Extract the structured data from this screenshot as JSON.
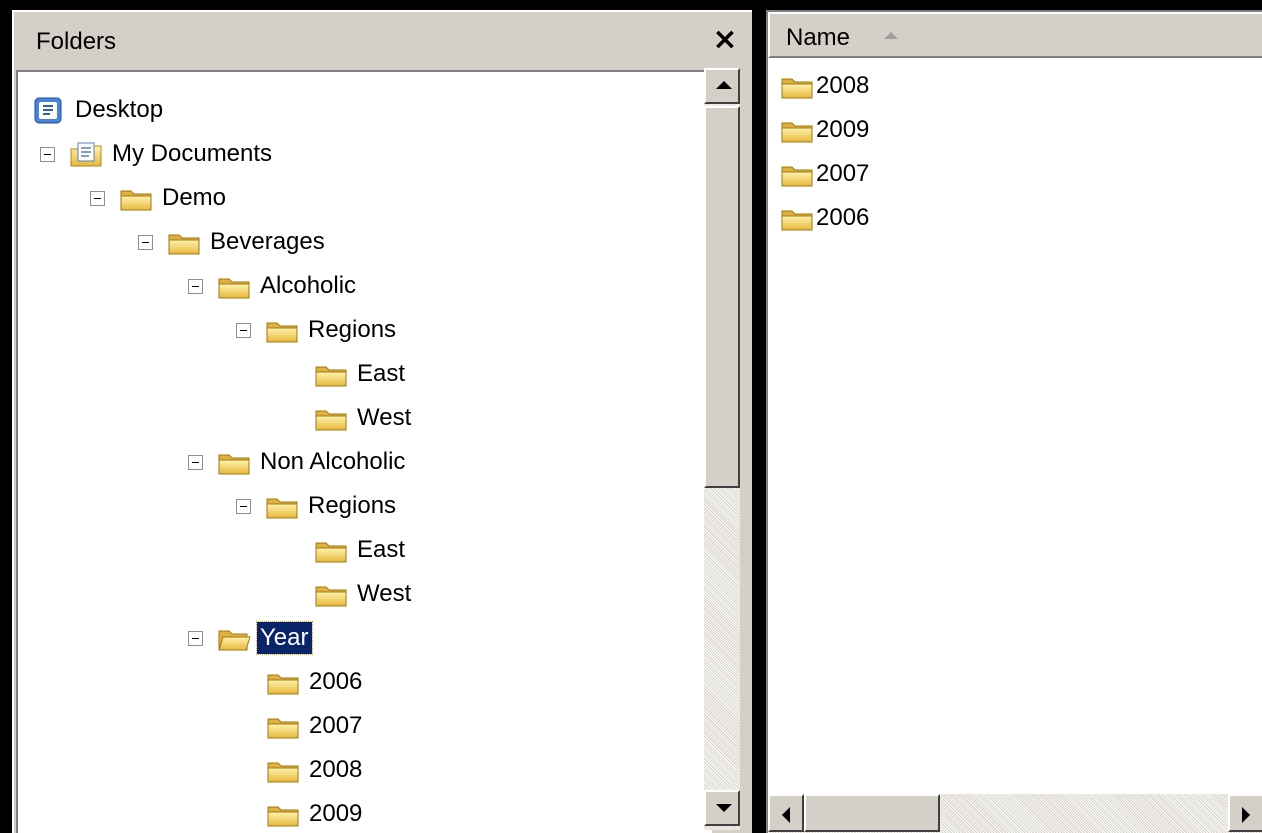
{
  "folders_pane": {
    "title": "Folders",
    "close_glyph": "×",
    "tree": [
      {
        "label": "Desktop",
        "icon": "desktop-icon",
        "expanded": null,
        "selected": false
      },
      {
        "label": "My Documents",
        "icon": "my-documents-icon",
        "expanded": true,
        "selected": false
      },
      {
        "label": "Demo",
        "icon": "folder-icon",
        "expanded": true,
        "selected": false
      },
      {
        "label": "Beverages",
        "icon": "folder-icon",
        "expanded": true,
        "selected": false
      },
      {
        "label": "Alcoholic",
        "icon": "folder-icon",
        "expanded": true,
        "selected": false
      },
      {
        "label": "Regions",
        "icon": "folder-icon",
        "expanded": true,
        "selected": false
      },
      {
        "label": "East",
        "icon": "folder-icon",
        "expanded": null,
        "selected": false
      },
      {
        "label": "West",
        "icon": "folder-icon",
        "expanded": null,
        "selected": false
      },
      {
        "label": "Non Alcoholic",
        "icon": "folder-icon",
        "expanded": true,
        "selected": false
      },
      {
        "label": "Regions",
        "icon": "folder-icon",
        "expanded": true,
        "selected": false
      },
      {
        "label": "East",
        "icon": "folder-icon",
        "expanded": null,
        "selected": false
      },
      {
        "label": "West",
        "icon": "folder-icon",
        "expanded": null,
        "selected": false
      },
      {
        "label": "Year",
        "icon": "folder-open-icon",
        "expanded": true,
        "selected": true
      },
      {
        "label": "2006",
        "icon": "folder-icon",
        "expanded": null,
        "selected": false
      },
      {
        "label": "2007",
        "icon": "folder-icon",
        "expanded": null,
        "selected": false
      },
      {
        "label": "2008",
        "icon": "folder-icon",
        "expanded": null,
        "selected": false
      },
      {
        "label": "2009",
        "icon": "folder-icon",
        "expanded": null,
        "selected": false
      }
    ]
  },
  "list_pane": {
    "column_name": "Name",
    "sort": "ascending",
    "items": [
      {
        "label": "2008",
        "icon": "folder-icon"
      },
      {
        "label": "2009",
        "icon": "folder-icon"
      },
      {
        "label": "2007",
        "icon": "folder-icon"
      },
      {
        "label": "2006",
        "icon": "folder-icon"
      }
    ]
  },
  "colors": {
    "selection_bg": "#0a246a",
    "selection_text": "#ffffff",
    "chrome": "#d4d0c8",
    "folder_yellow": "#f5d76e"
  }
}
